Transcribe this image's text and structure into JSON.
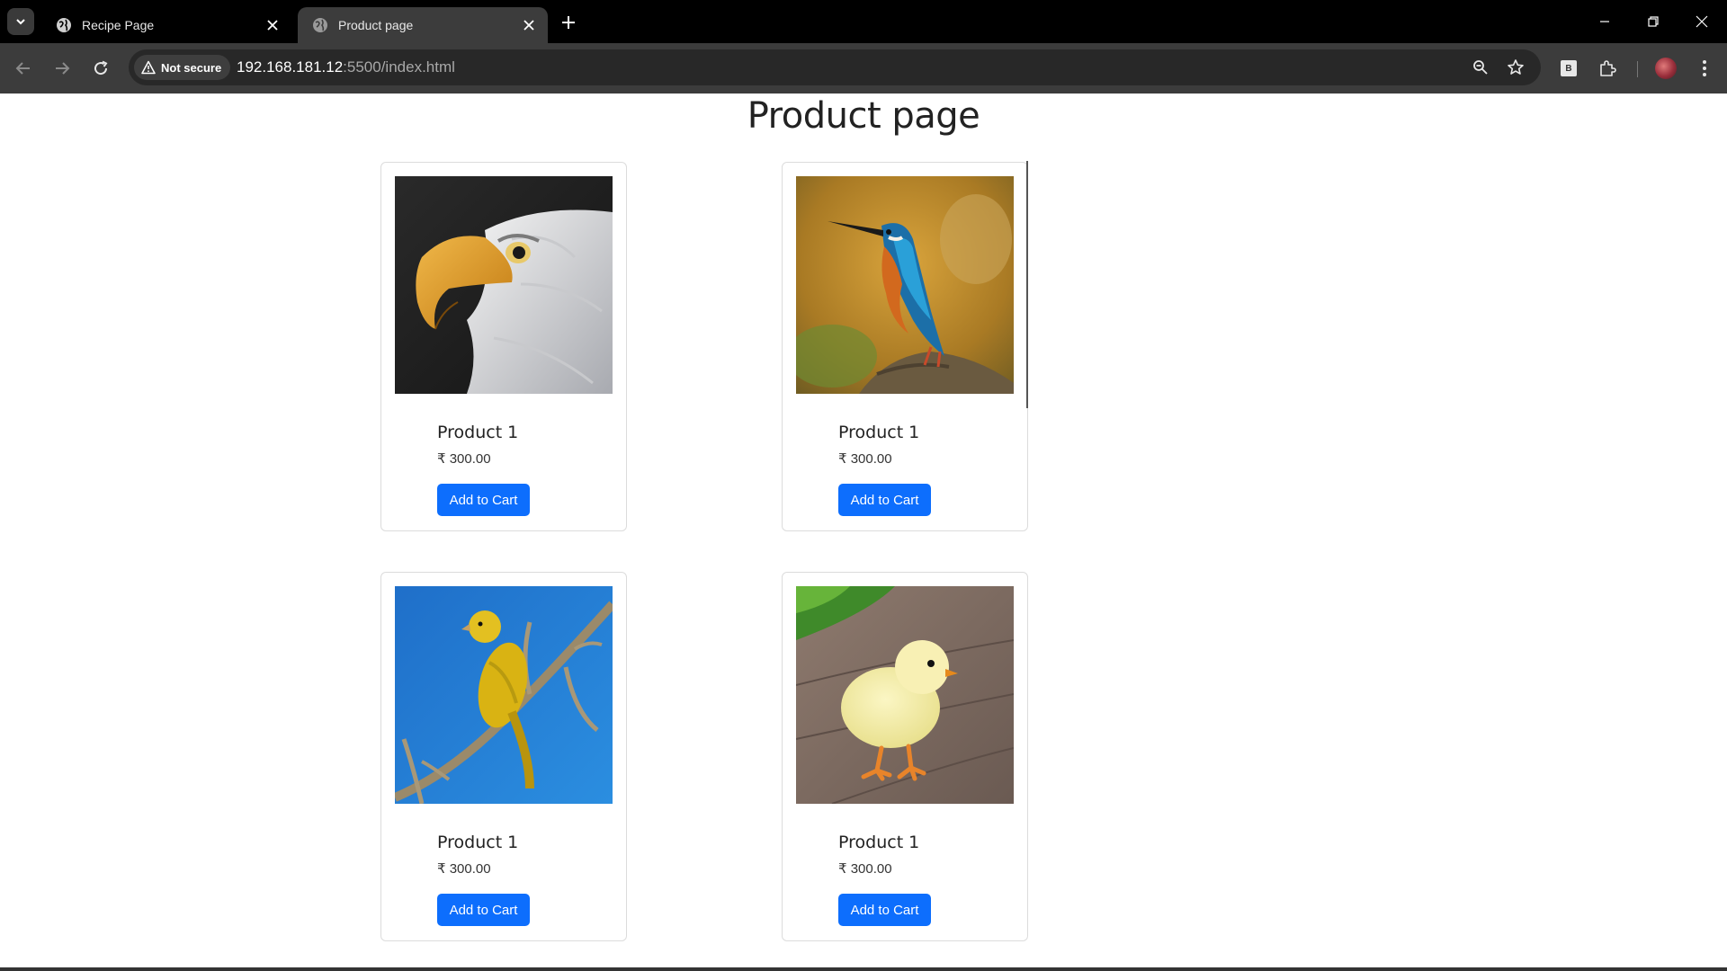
{
  "browser": {
    "tabs": [
      {
        "title": "Recipe Page",
        "active": false
      },
      {
        "title": "Product page",
        "active": true
      }
    ],
    "security_label": "Not secure",
    "url_host": "192.168.181.12",
    "url_rest": ":5500/index.html",
    "icons": [
      "tab-search-icon",
      "globe-icon",
      "close-icon",
      "plus-icon",
      "minimize-icon",
      "restore-icon",
      "back-icon",
      "forward-icon",
      "reload-icon",
      "warning-icon",
      "zoom-icon",
      "star-icon",
      "extension-b-icon",
      "puzzle-icon",
      "avatar",
      "more-vert-icon"
    ]
  },
  "page": {
    "title": "Product page",
    "products": [
      {
        "name": "Product 1",
        "price": "₹ 300.00",
        "button": "Add to Cart",
        "image": "bald-eagle-photo"
      },
      {
        "name": "Product 1",
        "price": "₹ 300.00",
        "button": "Add to Cart",
        "image": "kingfisher-photo"
      },
      {
        "name": "Product 1",
        "price": "₹ 300.00",
        "button": "Add to Cart",
        "image": "yellow-canary-photo"
      },
      {
        "name": "Product 1",
        "price": "₹ 300.00",
        "button": "Add to Cart",
        "image": "chick-photo"
      }
    ],
    "colors": {
      "button": "#0d6efd",
      "chrome_dark": "#000000",
      "toolbar": "#3c3c3c"
    }
  }
}
